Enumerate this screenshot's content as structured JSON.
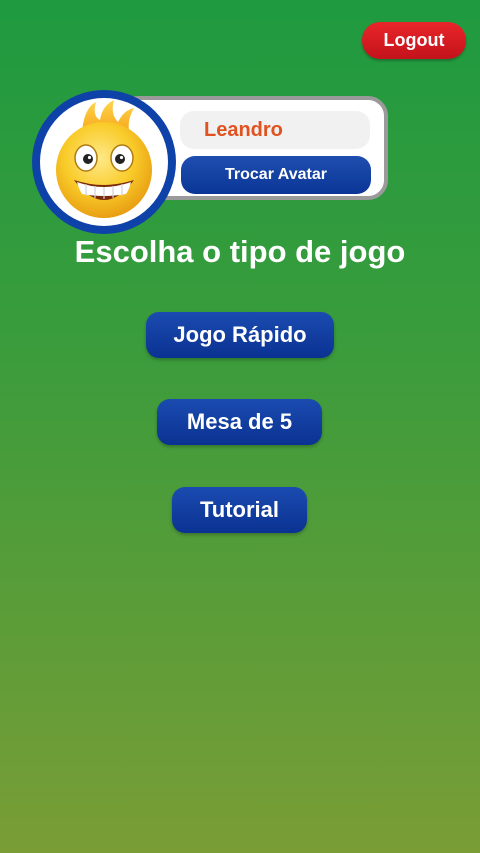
{
  "header": {
    "logout_label": "Logout"
  },
  "profile": {
    "username": "Leandro",
    "change_avatar_label": "Trocar Avatar",
    "avatar_icon": "smiling-flame-emoji-avatar"
  },
  "main": {
    "title": "Escolha o tipo de jogo",
    "buttons": [
      {
        "label": "Jogo Rápido"
      },
      {
        "label": "Mesa de 5"
      },
      {
        "label": "Tutorial"
      }
    ]
  },
  "colors": {
    "background_top": "#1f9a40",
    "background_bottom": "#7a9d36",
    "logout_red": "#d61c22",
    "button_blue": "#0a3596",
    "username_orange": "#e0521f"
  }
}
